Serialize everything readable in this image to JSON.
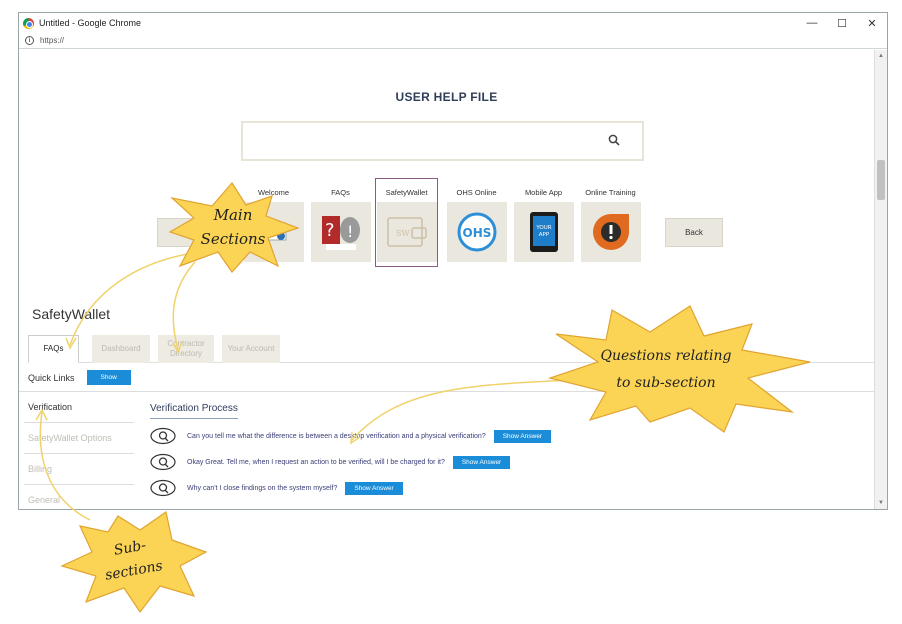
{
  "window": {
    "title": "Untitled - Google Chrome",
    "url": "https://",
    "controls": [
      "—",
      "☐",
      "✕"
    ]
  },
  "page": {
    "title": "USER HELP FILE",
    "search": {
      "value": "",
      "placeholder": ""
    }
  },
  "nav": {
    "back_left": "Back",
    "back_right": "Back",
    "items": [
      {
        "label": "Welcome",
        "icon": "welcome-icon"
      },
      {
        "label": "FAQs",
        "icon": "faq-heads-icon"
      },
      {
        "label": "SafetyWallet",
        "icon": "safetywallet-icon",
        "active": true,
        "tile_text": "SW"
      },
      {
        "label": "OHS Online",
        "icon": "ohs-icon",
        "tile_text": "OHS"
      },
      {
        "label": "Mobile App",
        "icon": "mobile-app-icon",
        "tile_text": "YOUR APP"
      },
      {
        "label": "Online Training",
        "icon": "online-training-icon"
      }
    ]
  },
  "section": {
    "heading": "SafetyWallet",
    "tabs": [
      {
        "label": "FAQs",
        "active": true
      },
      {
        "label": "Dashboard"
      },
      {
        "label": "Contractor Directory"
      },
      {
        "label": "Your Account"
      }
    ],
    "quick_links": {
      "label": "Quick Links",
      "button": "Show"
    }
  },
  "sidebar": {
    "items": [
      {
        "label": "Verification",
        "active": true
      },
      {
        "label": "SafetyWallet Options"
      },
      {
        "label": "Billing"
      },
      {
        "label": "General"
      }
    ]
  },
  "faq": {
    "heading": "Verification Process",
    "questions": [
      {
        "text": "Can you tell me what the difference is between a desktop verification and a physical verification?",
        "button": "Show Answer"
      },
      {
        "text": "Okay Great. Tell me, when I request an action to be verified, will I be charged for it?",
        "button": "Show Answer"
      },
      {
        "text": "Why can't I close findings on the system myself?",
        "button": "Show Answer"
      }
    ]
  },
  "annotations": {
    "main_sections": [
      "Main",
      "Sections"
    ],
    "questions": [
      "Questions relating",
      "to sub-section"
    ],
    "sub_sections": [
      "Sub-",
      "sections"
    ]
  },
  "colors": {
    "accent_blue": "#1a8cd8",
    "star_fill": "#fbd455",
    "arrow": "#f0d26a",
    "tile_bg": "#eae7df"
  }
}
